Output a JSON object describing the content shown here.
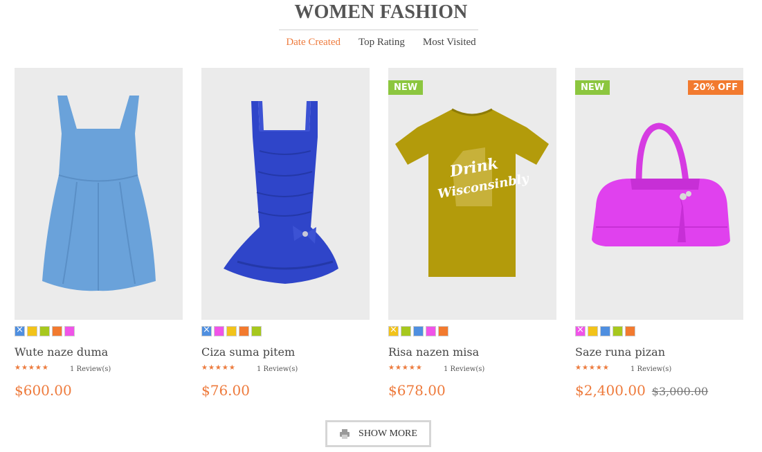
{
  "section": {
    "title": "WOMEN FASHION"
  },
  "tabs": [
    {
      "label": "Date Created",
      "active": true
    },
    {
      "label": "Top Rating",
      "active": false
    },
    {
      "label": "Most Visited",
      "active": false
    }
  ],
  "products": [
    {
      "name": "Wute naze duma",
      "rating": 4.5,
      "reviews": "1 Review(s)",
      "price": "$600.00",
      "old_price": "",
      "badge_new": "",
      "badge_sale": "",
      "image_icon": "blue-dress",
      "swatches": [
        "#4f8fe0",
        "#f2c31a",
        "#a7c81e",
        "#f27a2f",
        "#f054e8"
      ],
      "selected_swatch": 0
    },
    {
      "name": "Ciza suma pitem",
      "rating": 4.5,
      "reviews": "1 Review(s)",
      "price": "$76.00",
      "old_price": "",
      "badge_new": "",
      "badge_sale": "",
      "image_icon": "navy-dress",
      "swatches": [
        "#4f8fe0",
        "#f054e8",
        "#f2c31a",
        "#f27a2f",
        "#a7c81e"
      ],
      "selected_swatch": 0
    },
    {
      "name": "Risa nazen misa",
      "rating": 4.5,
      "reviews": "1 Review(s)",
      "price": "$678.00",
      "old_price": "",
      "badge_new": "NEW",
      "badge_sale": "",
      "image_icon": "mustard-tshirt",
      "tshirt_text_1": "Drink",
      "tshirt_text_2": "Wisconsinbly",
      "swatches": [
        "#f2c31a",
        "#a7c81e",
        "#4f8fe0",
        "#f054e8",
        "#f27a2f"
      ],
      "selected_swatch": 0
    },
    {
      "name": "Saze runa pizan",
      "rating": 4.5,
      "reviews": "1 Review(s)",
      "price": "$2,400.00",
      "old_price": "$3,000.00",
      "badge_new": "NEW",
      "badge_sale": "20% OFF",
      "image_icon": "magenta-handbag",
      "swatches": [
        "#f054e8",
        "#f2c31a",
        "#4f8fe0",
        "#a7c81e",
        "#f27a2f"
      ],
      "selected_swatch": 0
    }
  ],
  "show_more": {
    "label": "SHOW MORE",
    "icon": "printer-icon"
  },
  "colors": {
    "accent": "#ee7b3d",
    "new_badge": "#8cc63f",
    "sale_badge": "#f27a2f"
  }
}
